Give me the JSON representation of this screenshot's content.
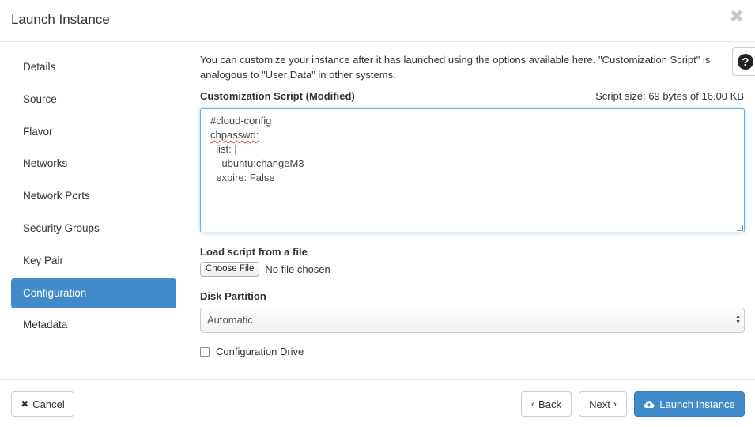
{
  "dialog": {
    "title": "Launch Instance",
    "close_glyph": "✖"
  },
  "sidebar": {
    "items": [
      {
        "label": "Details"
      },
      {
        "label": "Source"
      },
      {
        "label": "Flavor"
      },
      {
        "label": "Networks"
      },
      {
        "label": "Network Ports"
      },
      {
        "label": "Security Groups"
      },
      {
        "label": "Key Pair"
      },
      {
        "label": "Configuration",
        "active": true
      },
      {
        "label": "Metadata"
      }
    ]
  },
  "help": {
    "glyph": "?"
  },
  "intro_text": "You can customize your instance after it has launched using the options available here. \"Customization Script\" is analogous to \"User Data\" in other systems.",
  "script": {
    "label": "Customization Script (Modified)",
    "size_text": "Script size: 69 bytes of 16.00 KB",
    "lines": [
      "#cloud-config",
      "chpasswd:",
      "  list: |",
      "    ubuntu:changeM3",
      "  expire: False"
    ]
  },
  "load_script": {
    "label": "Load script from a file",
    "button_label": "Choose File",
    "status": "No file chosen"
  },
  "disk_partition": {
    "label": "Disk Partition",
    "selected": "Automatic"
  },
  "config_drive": {
    "label": "Configuration Drive",
    "checked": false
  },
  "footer": {
    "cancel_label": "Cancel",
    "back_label": "Back",
    "next_label": "Next",
    "launch_label": "Launch Instance"
  },
  "colors": {
    "accent": "#428bca",
    "focus_border": "#66afe9"
  }
}
